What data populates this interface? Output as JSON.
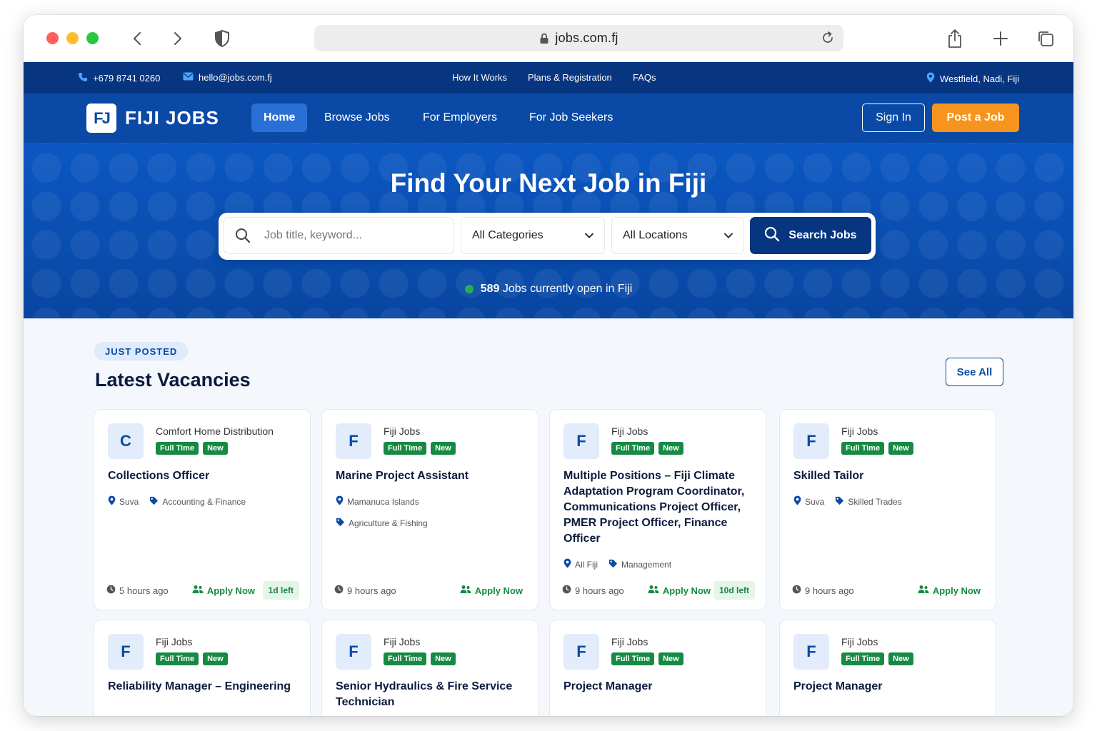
{
  "browser": {
    "url": "jobs.com.fj"
  },
  "infobar": {
    "phone": "+679 8741 0260",
    "email": "hello@jobs.com.fj",
    "links": [
      "How It Works",
      "Plans & Registration",
      "FAQs"
    ],
    "location": "Westfield, Nadi, Fiji"
  },
  "nav": {
    "logo_mark": "FJ",
    "logo_text": "FIJI JOBS",
    "links": [
      "Home",
      "Browse Jobs",
      "For Employers",
      "For Job Seekers"
    ],
    "active": "Home",
    "signin": "Sign In",
    "post": "Post a Job"
  },
  "hero": {
    "title": "Find Your Next Job in Fiji",
    "search_placeholder": "Job title, keyword...",
    "category": "All Categories",
    "location": "All Locations",
    "search_button": "Search Jobs",
    "job_count": "589",
    "job_count_text": "Jobs currently open in Fiji"
  },
  "section": {
    "pill": "JUST POSTED",
    "title": "Latest Vacancies",
    "see_all": "See All"
  },
  "jobs": [
    {
      "initial": "C",
      "company": "Comfort Home Distribution",
      "type": "Full Time",
      "badge": "New",
      "title": "Collections Officer",
      "location": "Suva",
      "category": "Accounting & Finance",
      "posted": "5 hours ago",
      "apply": "Apply Now",
      "left": "1d left"
    },
    {
      "initial": "F",
      "company": "Fiji Jobs",
      "type": "Full Time",
      "badge": "New",
      "title": "Marine Project Assistant",
      "location": "Mamanuca Islands",
      "category": "Agriculture & Fishing",
      "posted": "9 hours ago",
      "apply": "Apply Now",
      "left": ""
    },
    {
      "initial": "F",
      "company": "Fiji Jobs",
      "type": "Full Time",
      "badge": "New",
      "title": "Multiple Positions – Fiji Climate Adaptation Program Coordinator, Communications Project Officer, PMER Project Officer, Finance Officer",
      "location": "All Fiji",
      "category": "Management",
      "posted": "9 hours ago",
      "apply": "Apply Now",
      "left": "10d left"
    },
    {
      "initial": "F",
      "company": "Fiji Jobs",
      "type": "Full Time",
      "badge": "New",
      "title": "Skilled Tailor",
      "location": "Suva",
      "category": "Skilled Trades",
      "posted": "9 hours ago",
      "apply": "Apply Now",
      "left": ""
    },
    {
      "initial": "F",
      "company": "Fiji Jobs",
      "type": "Full Time",
      "badge": "New",
      "title": "Reliability Manager – Engineering"
    },
    {
      "initial": "F",
      "company": "Fiji Jobs",
      "type": "Full Time",
      "badge": "New",
      "title": "Senior Hydraulics & Fire Service Technician"
    },
    {
      "initial": "F",
      "company": "Fiji Jobs",
      "type": "Full Time",
      "badge": "New",
      "title": "Project Manager"
    },
    {
      "initial": "F",
      "company": "Fiji Jobs",
      "type": "Full Time",
      "badge": "New",
      "title": "Project Manager"
    }
  ]
}
